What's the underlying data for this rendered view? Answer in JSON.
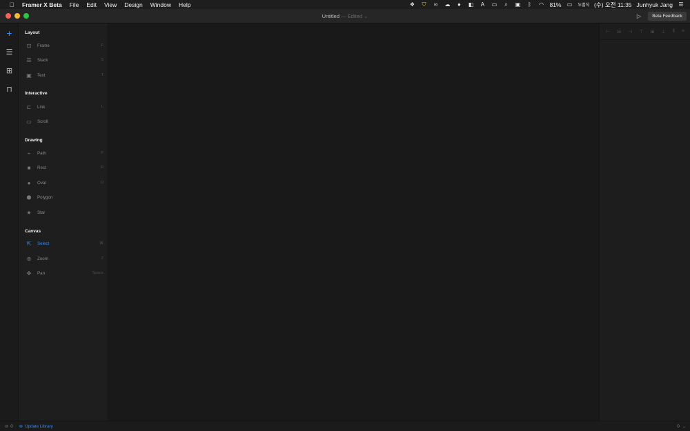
{
  "menubar": {
    "apple_icon": "apple-logo",
    "app_name": "Framer X Beta",
    "items": [
      "File",
      "Edit",
      "View",
      "Design",
      "Window",
      "Help"
    ],
    "battery": "81%",
    "input_method": "두벌식",
    "clock": "(수) 오전 11:35",
    "user": "Junhyuk Jang"
  },
  "titlebar": {
    "title": "Untitled",
    "separator": "—",
    "status": "Edited",
    "status_chevron": "⌄",
    "feedback_label": "Beta Feedback",
    "preview_icon": "play-icon"
  },
  "rail": {
    "icons": [
      "plus-icon",
      "layers-icon",
      "components-icon",
      "store-icon"
    ]
  },
  "tools": {
    "layout": {
      "title": "Layout",
      "items": [
        {
          "label": "Frame",
          "key": "F",
          "icon": "frame-icon"
        },
        {
          "label": "Stack",
          "key": "S",
          "icon": "stack-icon"
        },
        {
          "label": "Text",
          "key": "T",
          "icon": "text-icon"
        }
      ]
    },
    "interactive": {
      "title": "Interactive",
      "items": [
        {
          "label": "Link",
          "key": "L",
          "icon": "link-icon"
        },
        {
          "label": "Scroll",
          "key": "",
          "icon": "scroll-icon"
        }
      ]
    },
    "drawing": {
      "title": "Drawing",
      "items": [
        {
          "label": "Path",
          "key": "P",
          "icon": "path-icon"
        },
        {
          "label": "Rect",
          "key": "R",
          "icon": "rect-icon"
        },
        {
          "label": "Oval",
          "key": "O",
          "icon": "oval-icon"
        },
        {
          "label": "Polygon",
          "key": "",
          "icon": "polygon-icon"
        },
        {
          "label": "Star",
          "key": "",
          "icon": "star-icon"
        }
      ]
    },
    "canvas": {
      "title": "Canvas",
      "items": [
        {
          "label": "Select",
          "key": "⌘",
          "icon": "select-icon",
          "selected": true
        },
        {
          "label": "Zoom",
          "key": "Z",
          "icon": "zoom-icon"
        },
        {
          "label": "Pan",
          "key": "Space",
          "icon": "pan-icon"
        }
      ]
    }
  },
  "statusbar": {
    "warnings": "0",
    "update_library": "Update Library",
    "right_count": "0"
  },
  "colors": {
    "accent": "#2f8cff",
    "canvas": "#191919",
    "panel": "#1e1e1e"
  }
}
